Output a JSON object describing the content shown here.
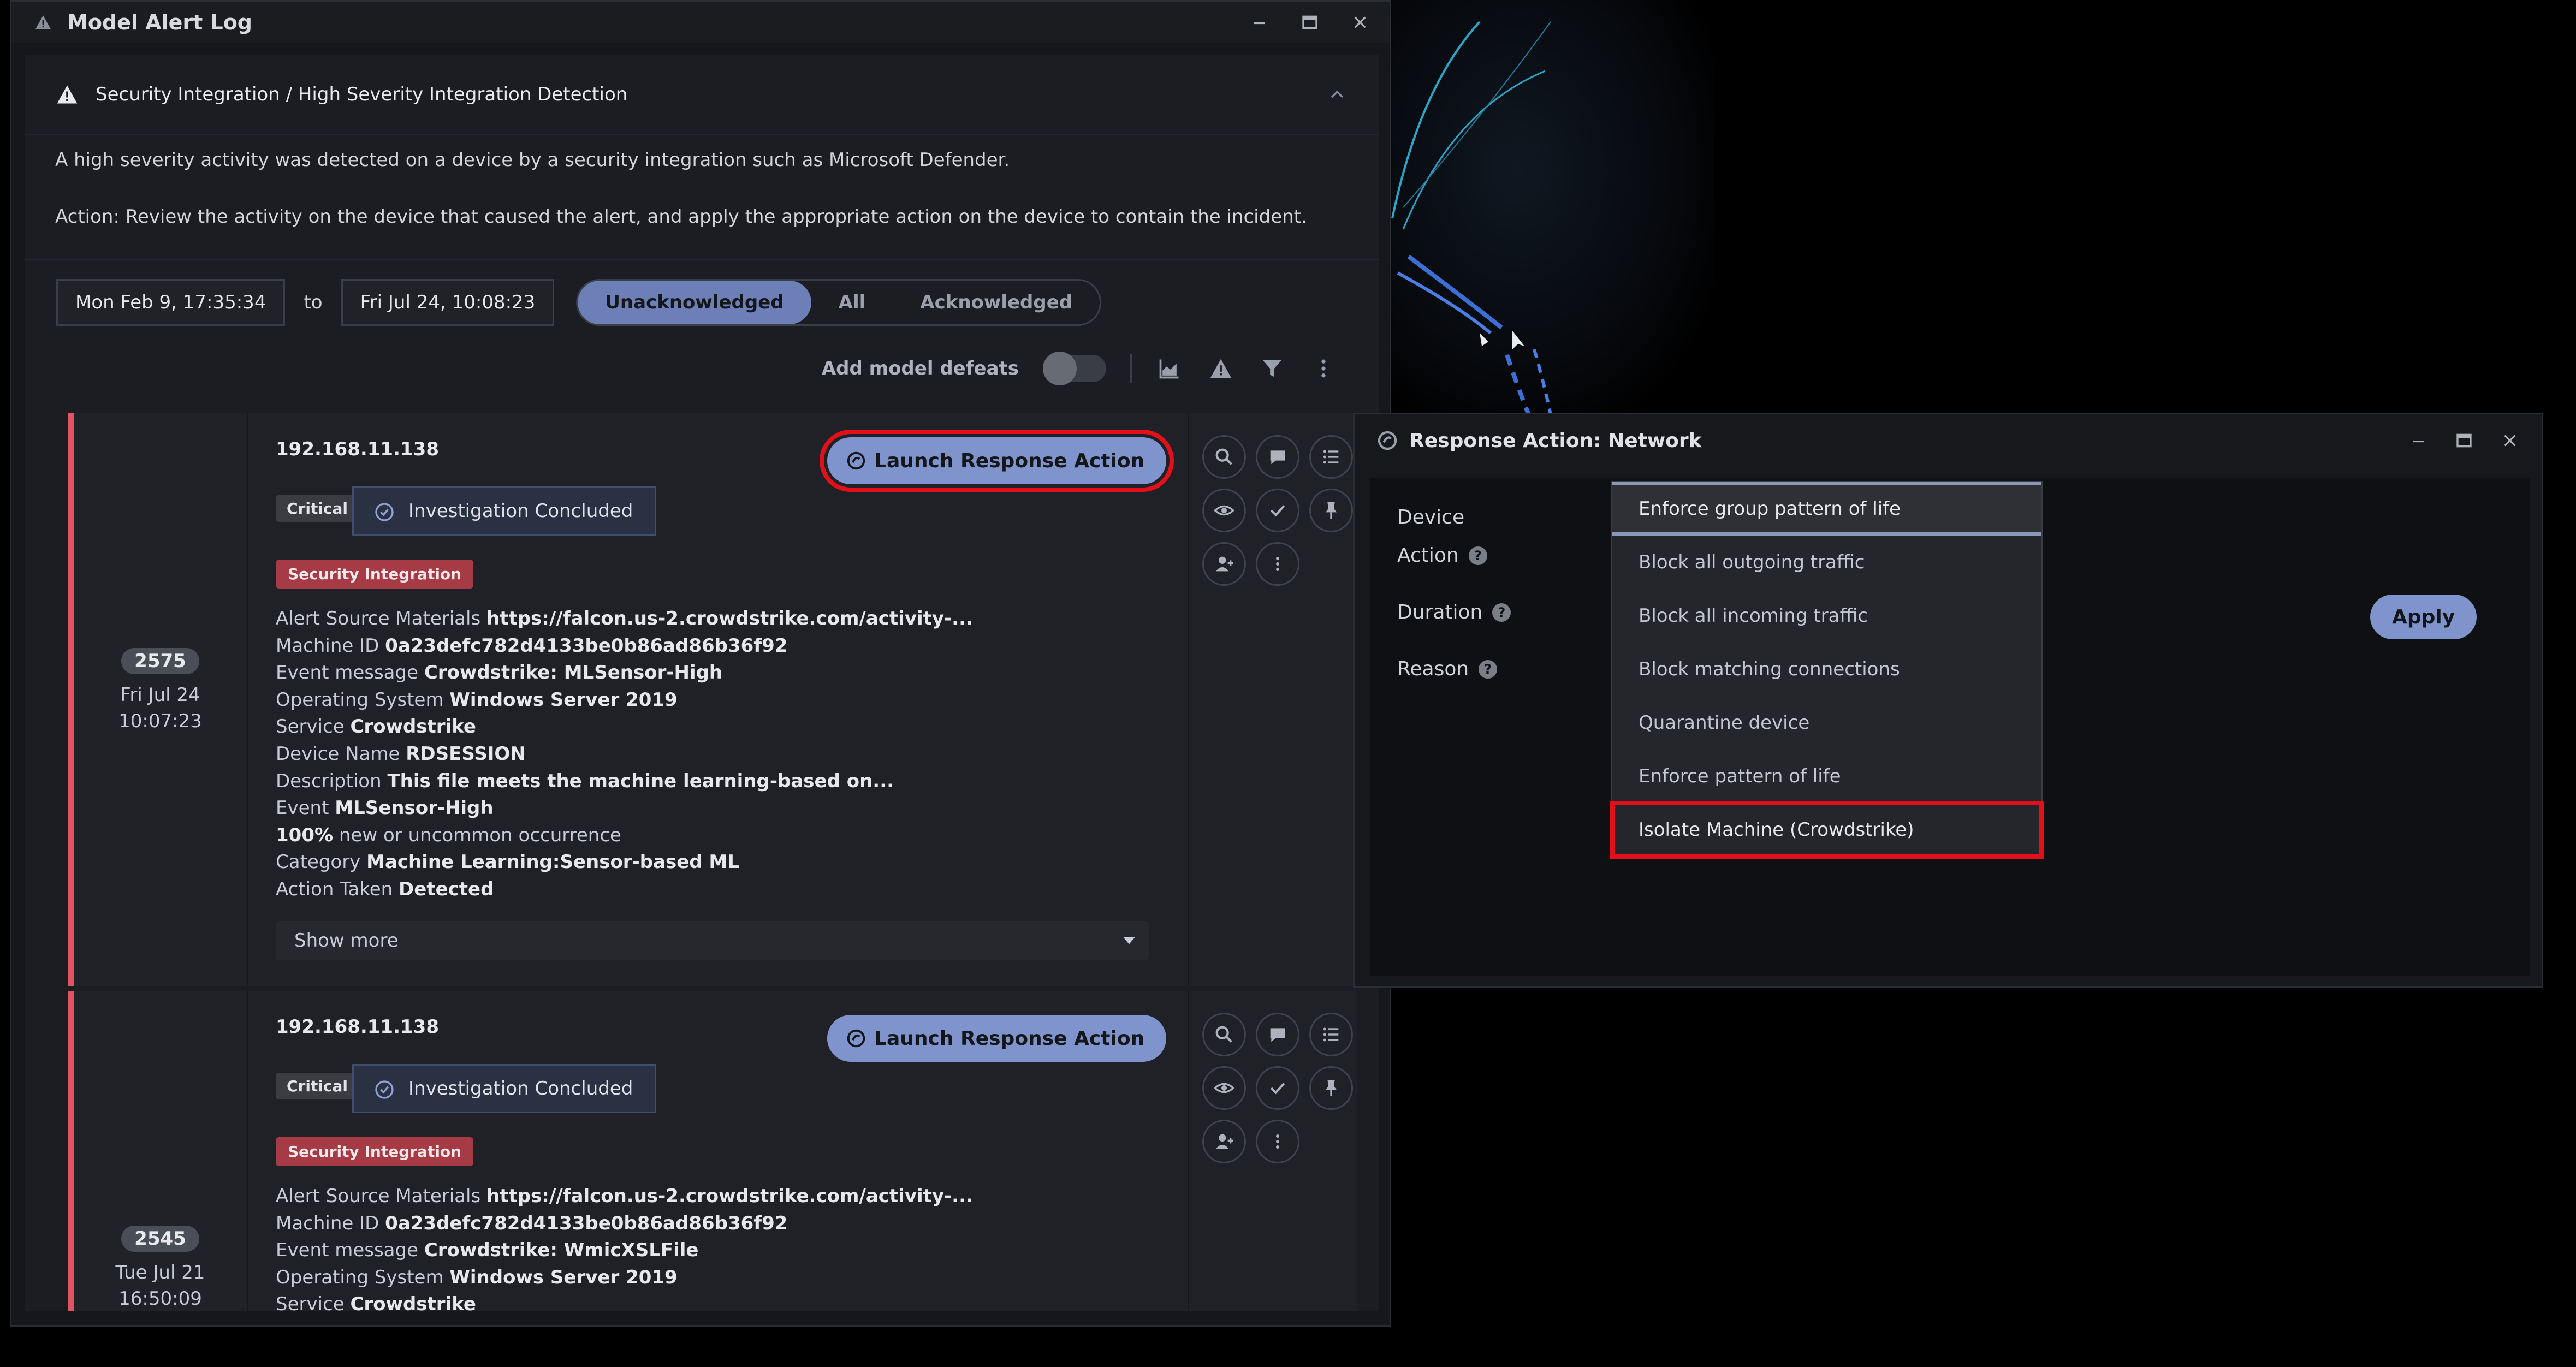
{
  "alert_log": {
    "window_title": "Model Alert Log",
    "model_title": "Security Integration / High Severity Integration Detection",
    "description": "A high severity activity was detected on a device by a security integration such as Microsoft Defender.",
    "action_text": "Action: Review the activity on the device that caused the alert, and apply the appropriate action on the device to contain the incident.",
    "date_from": "Mon Feb 9, 17:35:34",
    "date_to_label": "to",
    "date_to": "Fri Jul 24, 10:08:23",
    "filter_tabs": [
      "Unacknowledged",
      "All",
      "Acknowledged"
    ],
    "active_filter": "Unacknowledged",
    "defeats_label": "Add model defeats",
    "defeats_enabled": false
  },
  "alerts": [
    {
      "id": "2575",
      "date": "Fri Jul 24",
      "time": "10:07:23",
      "ip": "192.168.11.138",
      "launch_label": "Launch Response Action",
      "severity": "Critical",
      "status": "Investigation Concluded",
      "tag": "Security Integration",
      "fields": [
        {
          "k": "Alert Source Materials",
          "v": "https://falcon.us-2.crowdstrike.com/activity-..."
        },
        {
          "k": "Machine ID",
          "v": "0a23defc782d4133be0b86ad86b36f92"
        },
        {
          "k": "Event message",
          "v": "Crowdstrike: MLSensor-High"
        },
        {
          "k": "Operating System",
          "v": "Windows Server 2019"
        },
        {
          "k": "Service",
          "v": "Crowdstrike"
        },
        {
          "k": "Device Name",
          "v": "RDSESSION"
        },
        {
          "k": "Description",
          "v": "This file meets the machine learning-based on..."
        },
        {
          "k": "Event",
          "v": "MLSensor-High"
        },
        {
          "k": "100%",
          "v": "new or uncommon occurrence"
        },
        {
          "k": "Category",
          "v": "Machine Learning:Sensor-based ML"
        },
        {
          "k": "Action Taken",
          "v": "Detected"
        }
      ],
      "show_more": "Show more"
    },
    {
      "id": "2545",
      "date": "Tue Jul 21",
      "time": "16:50:09",
      "ip": "192.168.11.138",
      "launch_label": "Launch Response Action",
      "severity": "Critical",
      "status": "Investigation Concluded",
      "tag": "Security Integration",
      "fields": [
        {
          "k": "Alert Source Materials",
          "v": "https://falcon.us-2.crowdstrike.com/activity-..."
        },
        {
          "k": "Machine ID",
          "v": "0a23defc782d4133be0b86ad86b36f92"
        },
        {
          "k": "Event message",
          "v": "Crowdstrike: WmicXSLFile"
        },
        {
          "k": "Operating System",
          "v": "Windows Server 2019"
        },
        {
          "k": "Service",
          "v": "Crowdstrike"
        }
      ]
    }
  ],
  "response_action": {
    "window_title": "Response Action: Network",
    "labels": {
      "device": "Device",
      "action": "Action",
      "duration": "Duration",
      "reason": "Reason"
    },
    "help_glyph": "?",
    "apply_label": "Apply",
    "options": [
      "Enforce group pattern of life",
      "Block all outgoing traffic",
      "Block all incoming traffic",
      "Block matching connections",
      "Quarantine device",
      "Enforce pattern of life",
      "Isolate Machine (Crowdstrike)"
    ],
    "selected_option": "Enforce group pattern of life",
    "highlighted_option": "Isolate Machine (Crowdstrike)"
  },
  "colors": {
    "accent": "#7f94cd",
    "critical_stripe": "#e05561",
    "security_tag": "#a63b46",
    "highlight": "#e3101a"
  }
}
